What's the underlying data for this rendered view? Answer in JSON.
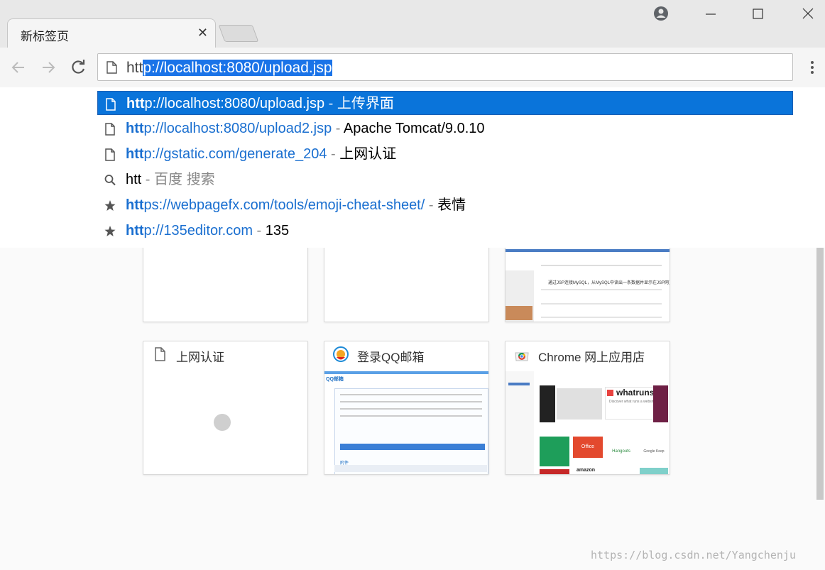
{
  "tab": {
    "title": "新标签页",
    "close": "✕"
  },
  "omnibox": {
    "typed": "htt",
    "completion": "p://localhost:8080/upload.jsp"
  },
  "suggestions": [
    {
      "icon": "page-icon",
      "match": "htt",
      "rest": "p://localhost:8080/upload.jsp",
      "sep": " - ",
      "title": "上传界面",
      "selected": true
    },
    {
      "icon": "page-icon",
      "match": "htt",
      "rest": "p://localhost:8080/upload2.jsp",
      "sep": " - ",
      "title": "Apache Tomcat/9.0.10"
    },
    {
      "icon": "page-icon",
      "match": "htt",
      "rest": "p://gstatic.com/generate_204",
      "sep": " - ",
      "title": "上网认证"
    },
    {
      "icon": "search-icon",
      "match": "htt",
      "rest": "",
      "sep": " - ",
      "title": "百度 搜索"
    },
    {
      "icon": "star-icon",
      "match": "htt",
      "rest": "ps://webpagefx.com/tools/emoji-cheat-sheet/",
      "sep": " - ",
      "title": "表情"
    },
    {
      "icon": "star-icon",
      "match": "htt",
      "rest": "p://135editor.com",
      "sep": " - ",
      "title": "135"
    }
  ],
  "tiles": [
    {
      "title": "上网认证"
    },
    {
      "title": "登录QQ邮箱"
    },
    {
      "title": "Chrome 网上应用店"
    }
  ],
  "thumb_text": {
    "whatruns": "whatruns",
    "whatruns_sub": "Discover what runs a website",
    "office": "Office",
    "hangouts": "Hangouts",
    "amazon": "amazon",
    "google_keep": "Google Keep",
    "qq_label": "QQ邮箱",
    "qq_sign": "附件",
    "bullet_row": "通过JSP连接MySQL，从MySQL中读出一条数据并显示在JSP网页中"
  },
  "watermark": "https://blog.csdn.net/Yangchenju",
  "colors": {
    "accent": "#0a74da",
    "url": "#1a6fd0"
  }
}
